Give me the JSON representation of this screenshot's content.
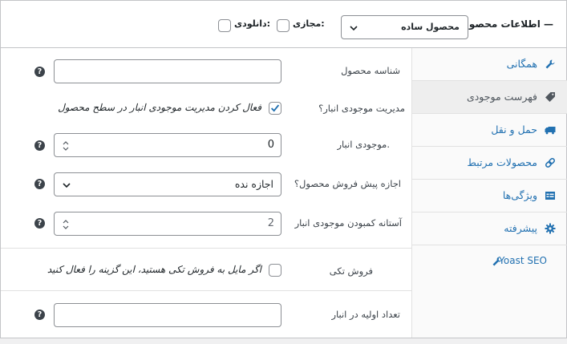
{
  "header": {
    "title": "اطلاعات محصول —",
    "product_type": "محصول ساده",
    "virtual_label": "مجازی:",
    "downloadable_label": "دانلودی:"
  },
  "tabs": [
    {
      "label": "همگانی",
      "icon": "wrench-icon",
      "active": false
    },
    {
      "label": "فهرست موجودی",
      "icon": "tag-icon",
      "active": true
    },
    {
      "label": "حمل و نقل",
      "icon": "truck-icon",
      "active": false
    },
    {
      "label": "محصولات مرتبط",
      "icon": "link-icon",
      "active": false
    },
    {
      "label": "ویژگی‌ها",
      "icon": "table-icon",
      "active": false
    },
    {
      "label": "پیشرفته",
      "icon": "gear-icon",
      "active": false
    },
    {
      "label": "Yoast SEO",
      "icon": "wrench-icon",
      "active": false
    }
  ],
  "form": {
    "sku_label": "شناسه محصول",
    "sku_value": "",
    "manage_stock_label": "مدیریت موجودی انبار؟",
    "manage_stock_text": "فعال کردن مدیریت موجودی انبار در سطح محصول",
    "manage_stock_checked": true,
    "stock_qty_label": "موجودی انبار.",
    "stock_qty_value": "0",
    "backorders_label": "اجازه پیش فروش محصول؟",
    "backorders_value": "اجازه نده",
    "low_stock_label": "آستانه کمبودن موجودی انبار",
    "low_stock_placeholder": "2",
    "sold_individually_label": "فروش تکی",
    "sold_individually_text": "اگر مایل به فروش تکی هستید، این گزینه را فعال کنید",
    "sold_individually_checked": false,
    "initial_stock_label": "تعداد اولیه در انبار",
    "initial_stock_value": "",
    "help_glyph": "?"
  },
  "colors": {
    "accent": "#2271b1",
    "border": "#8c8f94",
    "active_tab_bg": "#eeeeee"
  }
}
